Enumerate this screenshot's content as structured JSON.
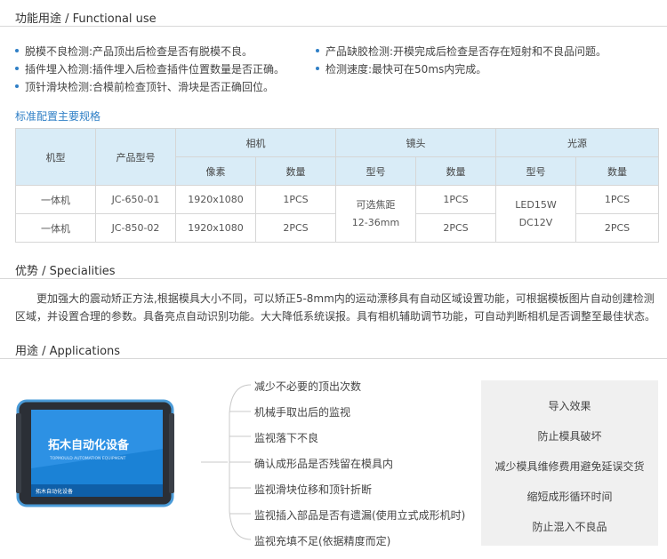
{
  "functional": {
    "title": "功能用途 / Functional use",
    "left_items": [
      "脱模不良检测:产品顶出后检查是否有脱模不良。",
      "插件埋入检测:插件埋入后检查插件位置数量是否正确。",
      "顶针滑块检测:合模前检查顶针、滑块是否正确回位。"
    ],
    "right_items": [
      "产品缺胶检测:开模完成后检查是否存在短射和不良品问题。",
      "检测速度:最快可在50ms内完成。"
    ]
  },
  "spec": {
    "title": "标准配置主要规格",
    "headers": {
      "model": "机型",
      "product_model": "产品型号",
      "camera": "相机",
      "lens": "镜头",
      "light": "光源",
      "pixels": "像素",
      "qty": "数量",
      "type": "型号"
    },
    "rows": [
      {
        "model": "一体机",
        "product_model": "JC-650-01",
        "pixels": "1920x1080",
        "camera_qty": "1PCS",
        "lens_qty": "1PCS",
        "light_qty": "1PCS"
      },
      {
        "model": "一体机",
        "product_model": "JC-850-02",
        "pixels": "1920x1080",
        "camera_qty": "2PCS",
        "lens_qty": "2PCS",
        "light_qty": "2PCS"
      }
    ],
    "lens_type_line1": "可选焦距",
    "lens_type_line2": "12-36mm",
    "light_type_line1": "LED15W",
    "light_type_line2": "DC12V"
  },
  "specialities": {
    "title": "优势 / Specialities",
    "text": "更加强大的震动矫正方法,根据模具大小不同，可以矫正5-8mm内的运动漂移具有自动区域设置功能，可根据模板图片自动创建检测区域，并设置合理的参数。具备亮点自动识别功能。大大降低系统误报。具有相机辅助调节功能，可自动判断相机是否调整至最佳状态。"
  },
  "applications": {
    "title": "用途 / Applications",
    "tablet_brand": "拓木自动化设备",
    "tablet_brand_en": "TOPMOULD AUTOMATION EQUIPMENT",
    "tablet_footer": "拓木自动化设备",
    "list": [
      "减少不必要的顶出次数",
      "机械手取出后的监视",
      "监视落下不良",
      "确认成形品是否残留在模具内",
      "监视滑块位移和顶针折断",
      "监视插入部品是否有遗漏(使用立式成形机时)",
      "监视充填不足(依据精度而定)"
    ],
    "results": [
      "导入效果",
      "防止模具破坏",
      "减少模具维修费用避免延误交货",
      "缩短成形循环时间",
      "防止混入不良品"
    ]
  },
  "colors": {
    "accent": "#2f7fc6",
    "header_bg": "#d9ecf7"
  }
}
